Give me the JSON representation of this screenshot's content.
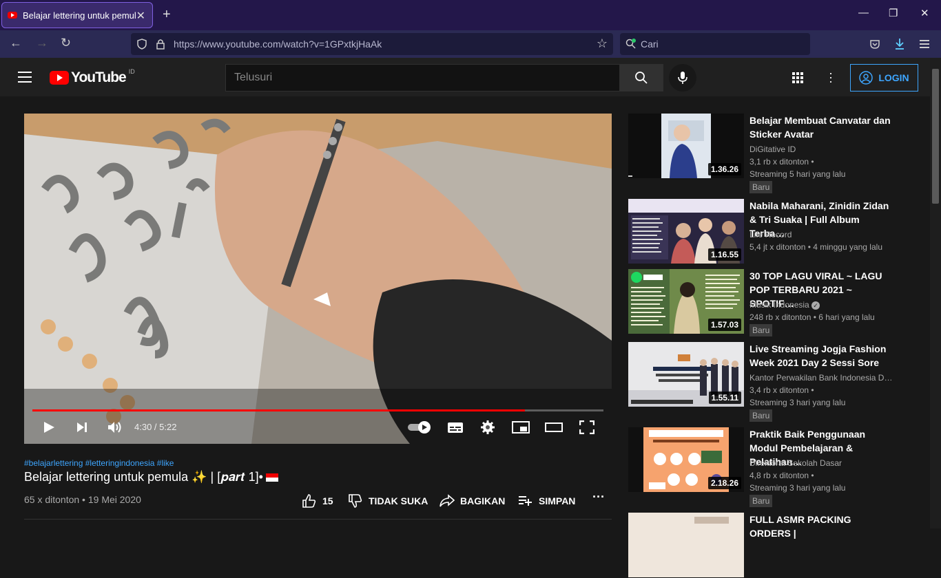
{
  "browser": {
    "tab_title": "Belajar lettering untuk pemula",
    "url": "https://www.youtube.com/watch?v=1GPxtkjHaAk",
    "search_placeholder": "Cari"
  },
  "youtube": {
    "logo_text": "YouTube",
    "country_code": "ID",
    "search_placeholder": "Telusuri",
    "login_label": "LOGIN"
  },
  "player": {
    "time": "4:30 / 5:22",
    "progress_fraction": 0.862
  },
  "video": {
    "hashtags": "#belajarlettering #letteringindonesia #like",
    "title": "Belajar lettering untuk pemula ✨ | [𝒑𝒂𝒓𝒕 1]•",
    "meta": "65 x ditonton • 19 Mei 2020",
    "likes": "15",
    "dislike_label": "TIDAK SUKA",
    "share_label": "BAGIKAN",
    "save_label": "SIMPAN"
  },
  "recommendations": [
    {
      "title": "Belajar Membuat Canvatar dan Sticker Avatar",
      "channel": "DiGitative ID",
      "views": "3,1 rb x ditonton •",
      "time": "Streaming 5 hari yang lalu",
      "duration": "1.36.26",
      "badge": "Baru"
    },
    {
      "title": "Nabila Maharani, Zinidin Zidan & Tri Suaka | Full Album Terba…",
      "channel": "Life Record",
      "views": "5,4 jt x ditonton • 4 minggu yang lalu",
      "time": "",
      "duration": "1.16.55",
      "badge": ""
    },
    {
      "title": "30 TOP LAGU VIRAL ~ LAGU POP TERBARU 2021 ~ SPOTIF…",
      "channel": "Musik Indonesia",
      "views": "248 rb x ditonton • 6 hari yang lalu",
      "time": "",
      "duration": "1.57.03",
      "badge": "Baru"
    },
    {
      "title": "Live Streaming Jogja Fashion Week 2021 Day 2 Sessi Sore",
      "channel": "Kantor Perwakilan Bank Indonesia D…",
      "views": "3,4 rb x ditonton •",
      "time": "Streaming 3 hari yang lalu",
      "duration": "1.55.11",
      "badge": "Baru"
    },
    {
      "title": "Praktik Baik Penggunaan Modul Pembelajaran & Pelatihan…",
      "channel": "Direktorat Sekolah Dasar",
      "views": "4,8 rb x ditonton •",
      "time": "Streaming 3 hari yang lalu",
      "duration": "2.18.26",
      "badge": "Baru"
    },
    {
      "title": "FULL ASMR PACKING ORDERS |",
      "channel": "",
      "views": "",
      "time": "",
      "duration": "",
      "badge": ""
    }
  ]
}
